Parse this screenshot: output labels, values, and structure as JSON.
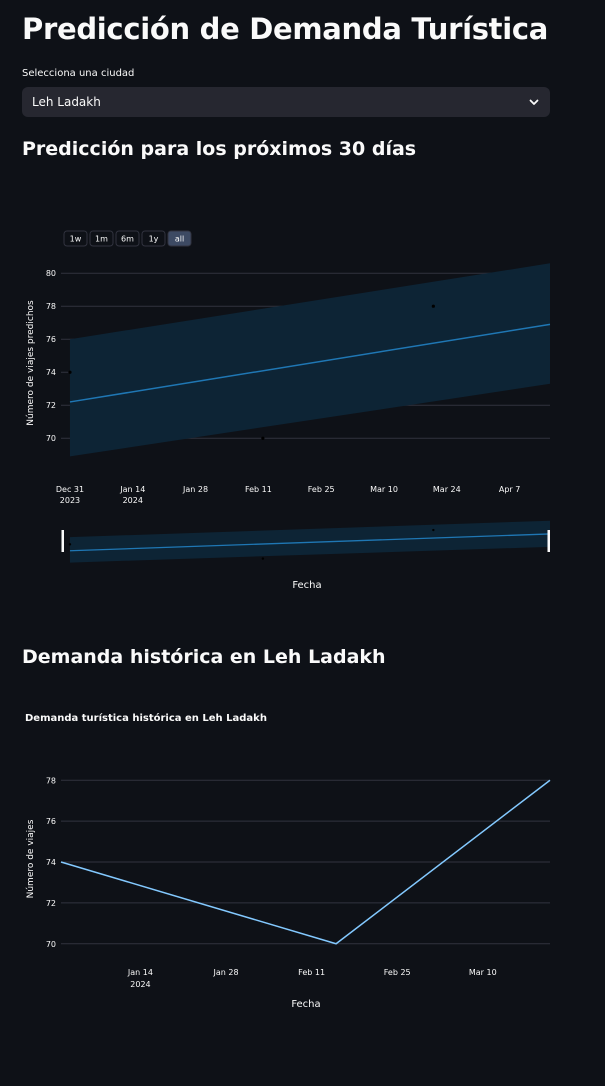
{
  "page": {
    "title": "Predicción de Demanda Turística",
    "select_label": "Selecciona una ciudad",
    "select_value": "Leh Ladakh",
    "forecast_heading": "Predicción para los próximos 30 días",
    "history_heading": "Demanda histórica en Leh Ladakh"
  },
  "colors": {
    "background": "#0e1117",
    "forecast_line": "#1f77b4",
    "band": "#0d2435",
    "history_line": "#83c9ff",
    "grid": "#31333f"
  },
  "chart_data": [
    {
      "type": "line",
      "title": "",
      "ylabel": "Número de viajes predichos",
      "xlabel": "Fecha",
      "ylim": [
        68.5,
        80.8
      ],
      "yticks": [
        70,
        72,
        74,
        76,
        78,
        80
      ],
      "xticks": [
        {
          "date": "2023-12-31",
          "label": "Dec 31",
          "sub": "2023"
        },
        {
          "date": "2024-01-14",
          "label": "Jan 14",
          "sub": "2024"
        },
        {
          "date": "2024-01-28",
          "label": "Jan 28",
          "sub": ""
        },
        {
          "date": "2024-02-11",
          "label": "Feb 11",
          "sub": ""
        },
        {
          "date": "2024-02-25",
          "label": "Feb 25",
          "sub": ""
        },
        {
          "date": "2024-03-10",
          "label": "Mar 10",
          "sub": ""
        },
        {
          "date": "2024-03-24",
          "label": "Mar 24",
          "sub": ""
        },
        {
          "date": "2024-04-07",
          "label": "Apr 7",
          "sub": ""
        }
      ],
      "xrange": [
        "2023-12-29",
        "2024-04-16"
      ],
      "range_buttons": [
        "1w",
        "1m",
        "6m",
        "1y",
        "all"
      ],
      "active_range_button": "all",
      "range_slider": true,
      "forecast": {
        "x": [
          "2023-12-31",
          "2024-04-16"
        ],
        "yhat": [
          72.2,
          76.9
        ],
        "upper": [
          76.0,
          80.6
        ],
        "lower": [
          68.9,
          73.3
        ]
      },
      "observed_points": [
        {
          "x": "2023-12-31",
          "y": 74
        },
        {
          "x": "2024-02-12",
          "y": 70
        },
        {
          "x": "2024-03-21",
          "y": 78
        }
      ]
    },
    {
      "type": "line",
      "title": "Demanda turística histórica en Leh Ladakh",
      "ylabel": "Número de viajes",
      "xlabel": "Fecha",
      "ylim": [
        69.5,
        78.6
      ],
      "yticks": [
        70,
        72,
        74,
        76,
        78
      ],
      "xticks": [
        {
          "date": "2024-01-14",
          "label": "Jan 14",
          "sub": "2024"
        },
        {
          "date": "2024-01-28",
          "label": "Jan 28",
          "sub": ""
        },
        {
          "date": "2024-02-11",
          "label": "Feb 11",
          "sub": ""
        },
        {
          "date": "2024-02-25",
          "label": "Feb 25",
          "sub": ""
        },
        {
          "date": "2024-03-10",
          "label": "Mar 10",
          "sub": ""
        }
      ],
      "xrange": [
        "2024-01-01",
        "2024-03-21"
      ],
      "series": [
        {
          "x": [
            "2024-01-01",
            "2024-02-15",
            "2024-03-21"
          ],
          "values": [
            74,
            70,
            78
          ]
        }
      ]
    }
  ]
}
